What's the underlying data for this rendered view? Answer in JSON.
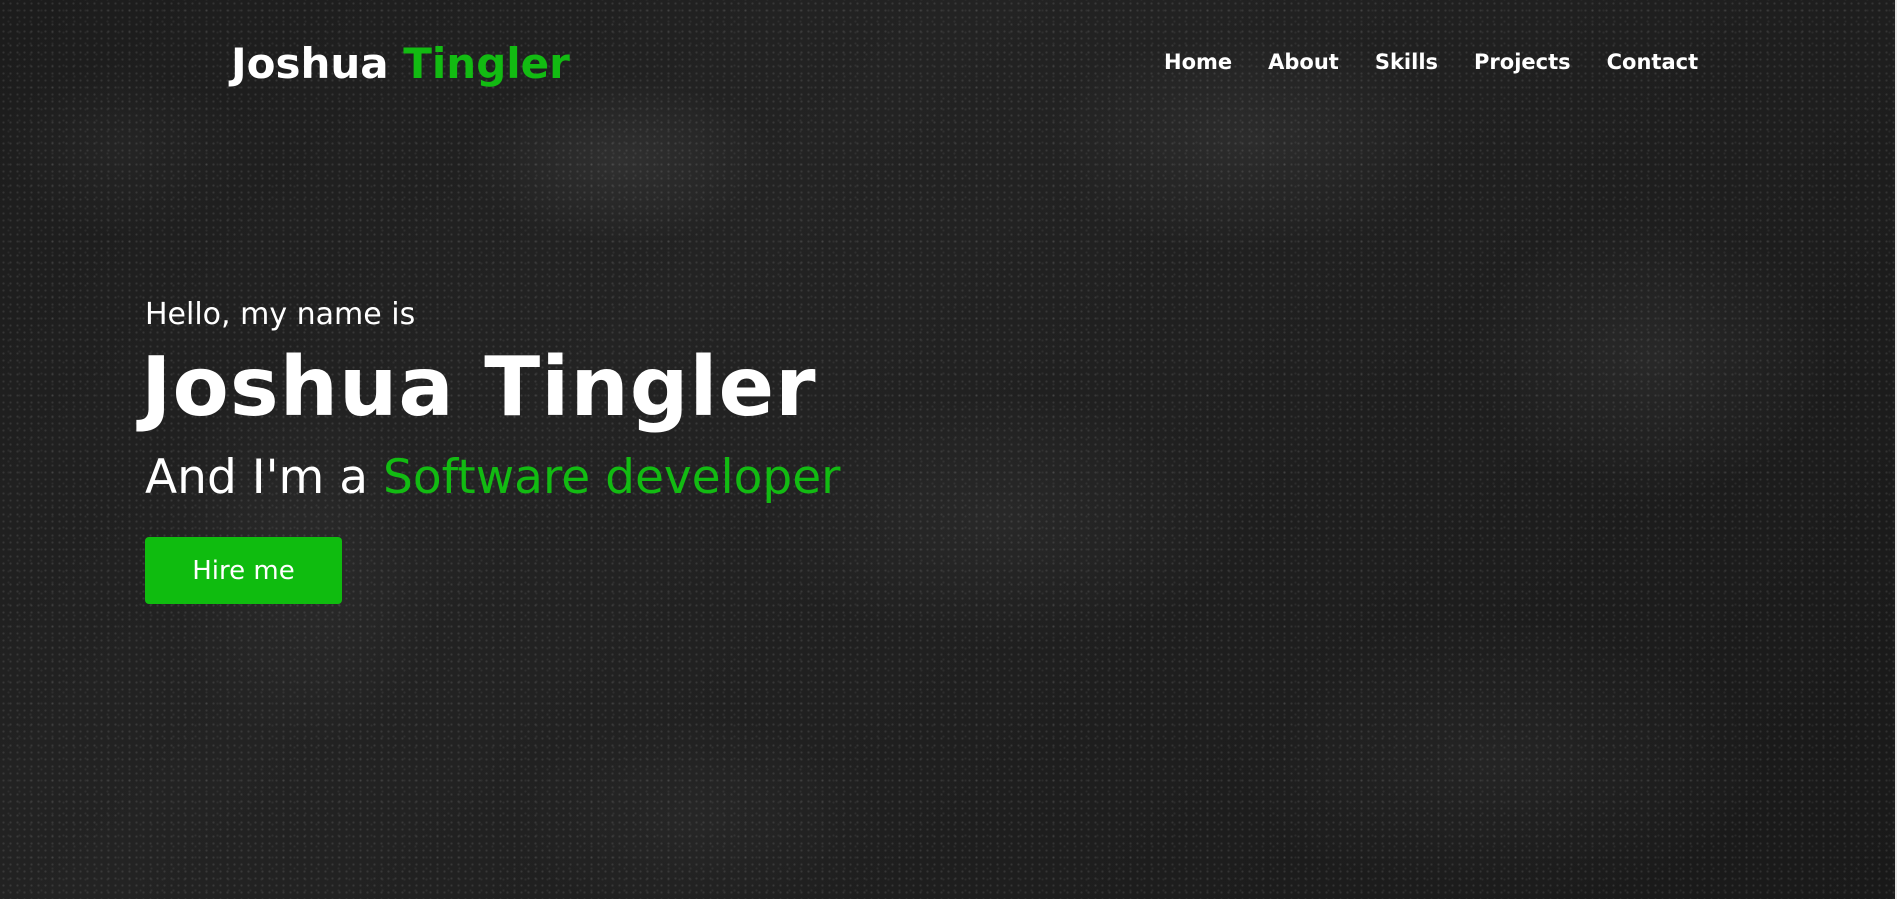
{
  "header": {
    "logo_first": "Joshua",
    "logo_second": "Tingler"
  },
  "nav": {
    "items": [
      {
        "label": "Home"
      },
      {
        "label": "About"
      },
      {
        "label": "Skills"
      },
      {
        "label": "Projects"
      },
      {
        "label": "Contact"
      }
    ]
  },
  "hero": {
    "greeting": "Hello, my name is",
    "name": "Joshua Tingler",
    "role_prefix": "And I'm a",
    "role_highlight": "Software developer",
    "cta_label": "Hire me"
  },
  "colors": {
    "accent": "#12bb12",
    "button": "#0fbc0f",
    "text": "#ffffff",
    "background": "#1e1e1e"
  }
}
